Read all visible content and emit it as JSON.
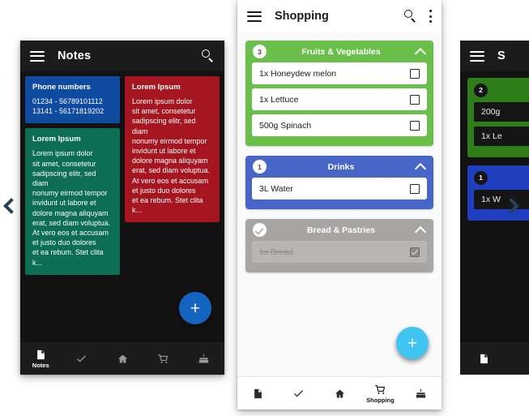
{
  "phone_notes": {
    "appbar": {
      "title": "Notes",
      "menu_icon": "hamburger-menu-icon",
      "search_icon": "search-icon"
    },
    "notes": [
      {
        "title": "Phone numbers",
        "body": "01234 - 56789101112\n13141 - 56171819202",
        "color": "#0f4ba0",
        "column": 0
      },
      {
        "title": "Lorem Ipsum",
        "body": "Lorem ipsum dolor\nsit amet, consetetur\nsadipscing elitr, sed diam\nnonumy eirmod tempor\ninvidunt ut labore et\ndolore magna aliquyam\nerat, sed diam voluptua.\nAt vero eos et accusam\net justo duo dolores\net ea rebum. Stet clita k...",
        "color": "#0c6e55",
        "column": 0
      },
      {
        "title": "Lorem Ipsum",
        "body": "Lorem ipsum dolor\nsit amet, consetetur\nsadipscing elitr, sed diam\nnonumy eirmod tempor\ninvidunt ut labore et\ndolore magna aliquyam\nerat, sed diam voluptua.\nAt vero eos et accusam\net justo duo dolores\net ea rebum. Stet clita k...",
        "color": "#a61621",
        "column": 1
      }
    ],
    "fab": {
      "label": "+",
      "color": "#1565c0"
    },
    "bottom_nav": {
      "background": "#1c1c1c",
      "items": [
        {
          "icon": "notes-document-icon",
          "label": "Notes",
          "active": true
        },
        {
          "icon": "checkmark-icon",
          "label": "",
          "active": false
        },
        {
          "icon": "home-icon",
          "label": "",
          "active": false
        },
        {
          "icon": "shopping-cart-icon",
          "label": "",
          "active": false
        },
        {
          "icon": "birthday-cake-icon",
          "label": "",
          "active": false
        }
      ]
    }
  },
  "phone_shopping": {
    "appbar": {
      "title": "Shopping",
      "menu_icon": "hamburger-menu-icon",
      "search_icon": "search-icon",
      "overflow_icon": "kebab-menu-icon"
    },
    "categories": [
      {
        "name": "Fruits & Vegetables",
        "badge": "3",
        "color": "#6abf4b",
        "collapse_icon": "chevron-up-icon",
        "completed": false,
        "items": [
          {
            "text": "1x Honeydew melon",
            "checked": false
          },
          {
            "text": "1x Lettuce",
            "checked": false
          },
          {
            "text": "500g Spinach",
            "checked": false
          }
        ]
      },
      {
        "name": "Drinks",
        "badge": "1",
        "color": "#4766c8",
        "collapse_icon": "chevron-up-icon",
        "completed": false,
        "items": [
          {
            "text": "3L Water",
            "checked": false
          }
        ]
      },
      {
        "name": "Bread & Pastries",
        "badge": "",
        "color": "#a8a6a4",
        "collapse_icon": "chevron-up-icon",
        "completed": true,
        "items": [
          {
            "text": "1x Bread",
            "checked": true
          }
        ]
      }
    ],
    "fab": {
      "label": "+",
      "color": "#40c4f0"
    },
    "bottom_nav": {
      "background": "#ffffff",
      "items": [
        {
          "icon": "notes-document-icon",
          "label": "",
          "active": false
        },
        {
          "icon": "checkmark-icon",
          "label": "",
          "active": false
        },
        {
          "icon": "home-icon",
          "label": "",
          "active": false
        },
        {
          "icon": "shopping-cart-icon",
          "label": "Shopping",
          "active": true
        },
        {
          "icon": "birthday-cake-icon",
          "label": "",
          "active": false
        }
      ]
    }
  },
  "phone_dark_shopping": {
    "appbar": {
      "title": "S",
      "menu_icon": "hamburger-menu-icon"
    },
    "categories": [
      {
        "name": "",
        "badge": "2",
        "color": "#2e7d18",
        "items": [
          {
            "text": "200g"
          },
          {
            "text": "1x Le"
          }
        ]
      },
      {
        "name": "",
        "badge": "1",
        "color": "#1f3fbe",
        "items": [
          {
            "text": "1x W"
          }
        ]
      }
    ],
    "bottom_nav": {
      "items": [
        {
          "icon": "notes-document-icon",
          "label": ""
        }
      ]
    }
  },
  "carousel": {
    "prev_icon": "chevron-left-icon",
    "next_icon": "chevron-right-icon",
    "prev_label": "",
    "next_label": ""
  }
}
